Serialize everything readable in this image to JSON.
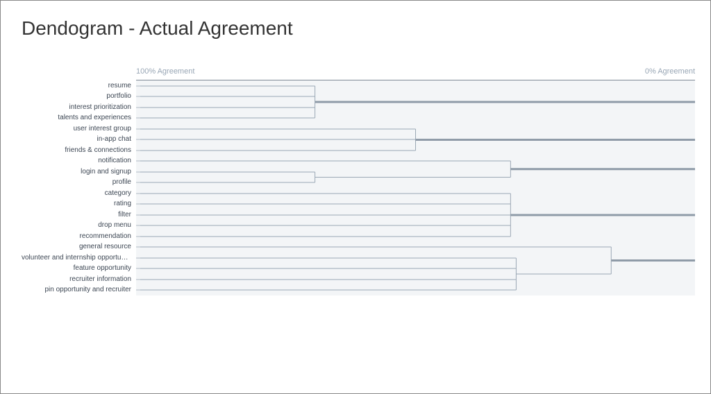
{
  "title": "Dendogram - Actual Agreement",
  "axis": {
    "left": "100% Agreement",
    "right": "0% Agreement"
  },
  "chart_data": {
    "type": "dendrogram",
    "title": "Dendogram - Actual Agreement",
    "xlabel": "Agreement",
    "xlim": [
      100,
      0
    ],
    "axis_note": "x-axis runs left=100% agreement to right=0% agreement; merge_at values are agreement percentages",
    "leaves": [
      "resume",
      "portfolio",
      "interest prioritization",
      "talents and experiences",
      "user interest group",
      "in-app chat",
      "friends & connections",
      "notification",
      "login and signup",
      "profile",
      "category",
      "rating",
      "filter",
      "drop menu",
      "recommendation",
      "general resource",
      "volunteer and internship opportuni…",
      "feature opportunity",
      "recruiter information",
      "pin opportunity and recruiter"
    ],
    "clusters": [
      {
        "id": "C1",
        "members": [
          "resume",
          "portfolio",
          "interest prioritization",
          "talents and experiences"
        ],
        "merge_at": 68
      },
      {
        "id": "C2",
        "members": [
          "user interest group",
          "in-app chat",
          "friends & connections"
        ],
        "merge_at": 50
      },
      {
        "id": "C3a",
        "members": [
          "login and signup",
          "profile"
        ],
        "merge_at": 68
      },
      {
        "id": "C3",
        "members": [
          "notification",
          "C3a"
        ],
        "merge_at": 33
      },
      {
        "id": "C4",
        "members": [
          "category",
          "rating",
          "filter",
          "drop menu",
          "recommendation"
        ],
        "merge_at": 33
      },
      {
        "id": "C5a",
        "members": [
          "volunteer and internship opportuni…",
          "feature opportunity",
          "recruiter information",
          "pin opportunity and recruiter"
        ],
        "merge_at": 32
      },
      {
        "id": "C5",
        "members": [
          "general resource",
          "C5a"
        ],
        "merge_at": 15
      },
      {
        "id": "ROOT",
        "members": [
          "C1",
          "C2",
          "C3",
          "C4",
          "C5"
        ],
        "merge_at": 0
      }
    ]
  }
}
